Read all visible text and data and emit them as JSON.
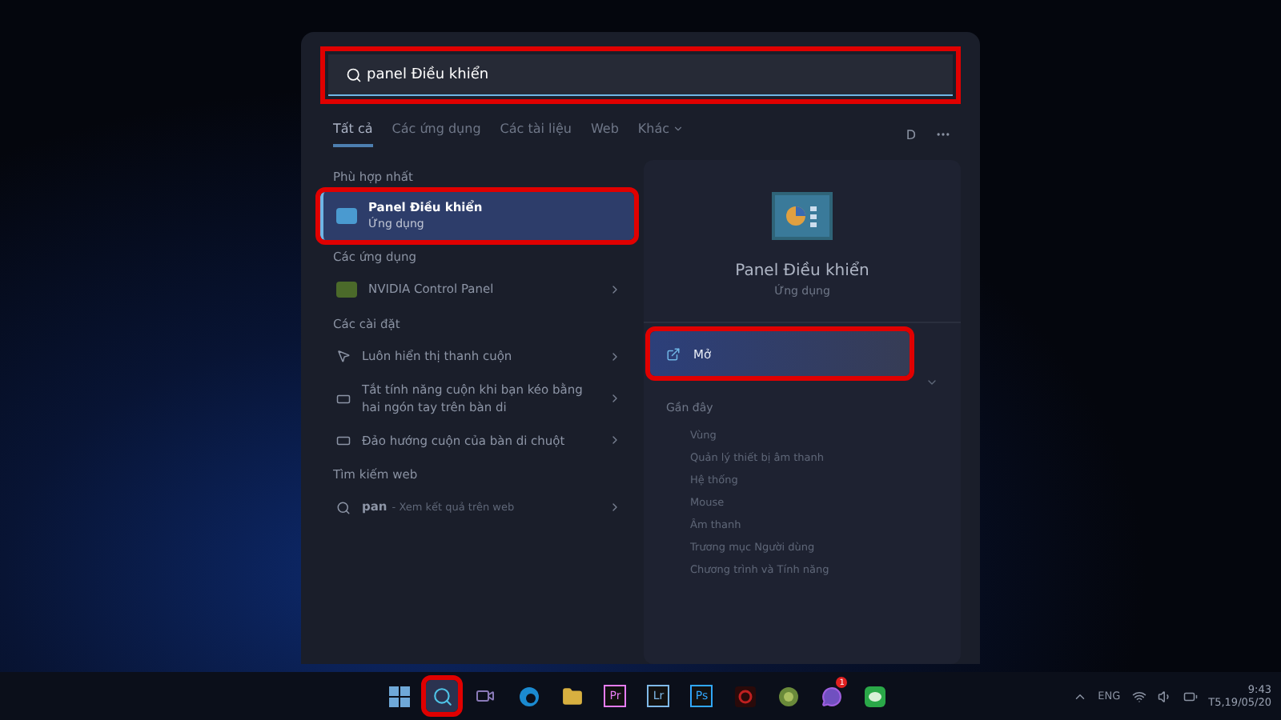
{
  "search": {
    "value": "panel Điều khiển",
    "highlighted": true
  },
  "tabs": [
    {
      "label": "Tất cả",
      "selected": true,
      "dropdown": false
    },
    {
      "label": "Các ứng dụng",
      "selected": false,
      "dropdown": false
    },
    {
      "label": "Các tài liệu",
      "selected": false,
      "dropdown": false
    },
    {
      "label": "Web",
      "selected": false,
      "dropdown": false
    },
    {
      "label": "Khác",
      "selected": false,
      "dropdown": true
    }
  ],
  "account_initial": "D",
  "sections": [
    {
      "title": "Phù hợp nhất",
      "items": [
        {
          "kind": "best",
          "title": "Panel Điều khiển",
          "subtitle": "Ứng dụng",
          "highlighted": true,
          "selected": true
        }
      ]
    },
    {
      "title": "Các ứng dụng",
      "items": [
        {
          "kind": "app",
          "title": "NVIDIA Control Panel"
        }
      ]
    },
    {
      "title": "Các cài đặt",
      "items": [
        {
          "kind": "setting",
          "title": "Luôn hiển thị thanh cuộn"
        },
        {
          "kind": "touchpad",
          "title": "Tắt tính năng cuộn khi bạn kéo bằng hai ngón tay trên bàn di"
        },
        {
          "kind": "touchpad",
          "title": "Đảo hướng cuộn của bàn di chuột"
        }
      ]
    },
    {
      "title": "Tìm kiếm web",
      "items": [
        {
          "kind": "web",
          "title": "pan",
          "subtitle": "- Xem kết quả trên web"
        }
      ]
    }
  ],
  "preview": {
    "title": "Panel Điều khiển",
    "subtitle": "Ứng dụng",
    "actions": [
      {
        "label": "Mở",
        "highlighted": true
      }
    ],
    "recent_title": "Gần đây",
    "recent": [
      "Vùng",
      "Quản lý thiết bị âm thanh",
      "Hệ thống",
      "Mouse",
      "Âm thanh",
      "Trương mục Người dùng",
      "Chương trình và Tính năng"
    ]
  },
  "taskbar": [
    {
      "kind": "start",
      "highlighted": false
    },
    {
      "kind": "search",
      "highlighted": true
    },
    {
      "kind": "chat",
      "highlighted": false
    },
    {
      "kind": "edge",
      "highlighted": false
    },
    {
      "kind": "folder",
      "highlighted": false
    },
    {
      "kind": "letters",
      "label": "Pr",
      "color": "#e77cf5",
      "highlighted": false
    },
    {
      "kind": "letters",
      "label": "Lr",
      "color": "#7fb9e8",
      "highlighted": false
    },
    {
      "kind": "letters",
      "label": "Ps",
      "color": "#31a8ff",
      "highlighted": false
    },
    {
      "kind": "red",
      "highlighted": false
    },
    {
      "kind": "green-circle",
      "highlighted": false
    },
    {
      "kind": "messenger",
      "badge": "1",
      "highlighted": false
    },
    {
      "kind": "line",
      "highlighted": false
    }
  ],
  "tray": {
    "language": "ENG",
    "time": "9:43",
    "date": "T5,19/05/20"
  }
}
